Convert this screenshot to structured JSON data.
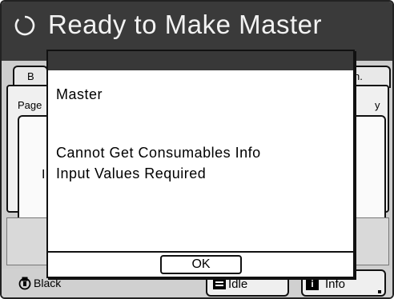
{
  "header": {
    "title": "Ready to Make Master",
    "status_icon": "ring-icon"
  },
  "background": {
    "tab_left_label": "B",
    "tab_right_label": "n.",
    "panel_left_label": "Page",
    "panel_right_label": "y",
    "field_left_char": "I"
  },
  "status_bar": {
    "ink_label": "Black",
    "idle_label": "Idle",
    "info_label": "Info"
  },
  "dialog": {
    "heading": "Master",
    "line1": "Cannot Get Consumables Info",
    "line2": "Input Values Required",
    "ok_label": "OK"
  },
  "colors": {
    "title_bar": "#3a3a3a",
    "body_gray": "#cdcdcd",
    "dialog_bg": "#ffffff"
  }
}
